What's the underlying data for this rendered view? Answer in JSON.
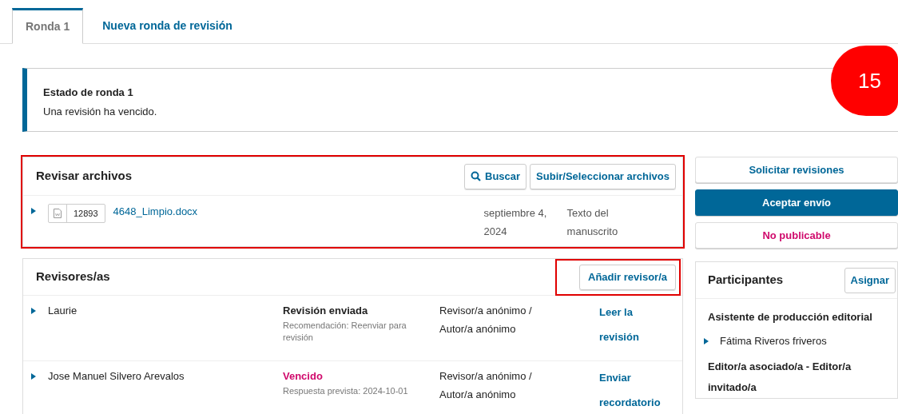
{
  "tabs": [
    {
      "label": "Ronda 1",
      "selected": true
    },
    {
      "label": "Nueva ronda de revisión",
      "selected": false
    }
  ],
  "notice": {
    "title": "Estado de ronda 1",
    "text": "Una revisión ha vencido."
  },
  "annotation_badge": "15",
  "files_panel": {
    "title": "Revisar archivos",
    "highlighted": true,
    "buttons": [
      {
        "label": "Buscar",
        "kind": "search"
      },
      {
        "label": "Subir/Seleccionar archivos",
        "kind": "plain"
      }
    ],
    "files": [
      {
        "id": "12893",
        "name": "4648_Limpio.docx",
        "date": "septiembre 4, 2024",
        "type": "Texto del manuscrito"
      }
    ]
  },
  "reviewers_panel": {
    "title": "Revisores/as",
    "add_button": {
      "label": "Añadir revisor/a",
      "highlighted": true
    },
    "reviewers": [
      {
        "name": "Laurie",
        "status": "Revisión enviada",
        "kind": "submitted",
        "detail": "Recomendación: Reenviar para revisión",
        "role": "Revisor/a anónimo / Autor/a anónimo",
        "action": "Leer la revisión"
      },
      {
        "name": "Jose Manuel Silvero Arevalos",
        "status": "Vencido",
        "kind": "overdue",
        "detail": "Respuesta prevista: 2024-10-01",
        "role": "Revisor/a anónimo / Autor/a anónimo",
        "action": "Enviar recordatorio"
      }
    ]
  },
  "decision_buttons": [
    {
      "label": "Solicitar revisiones",
      "kind": "default"
    },
    {
      "label": "Aceptar envío",
      "kind": "primary"
    },
    {
      "label": "No publicable",
      "kind": "danger"
    }
  ],
  "participants": {
    "title": "Participantes",
    "assign_button": "Asignar",
    "groups": [
      {
        "role": "Asistente de producción editorial",
        "members": [
          "Fátima Riveros friveros"
        ]
      },
      {
        "role": "Editor/a asociado/a - Editor/a invitado/a"
      }
    ]
  }
}
